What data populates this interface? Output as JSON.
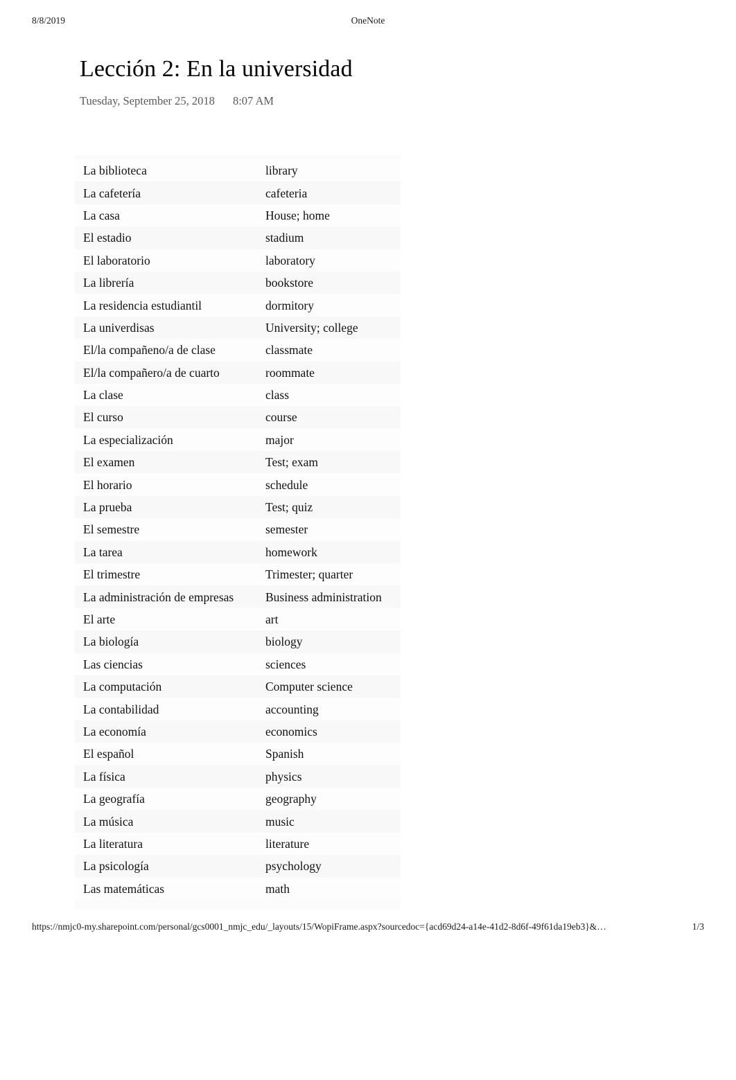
{
  "print_header": {
    "date": "8/8/2019",
    "app_name": "OneNote"
  },
  "note": {
    "title": "Lección 2: En la universidad",
    "date": "Tuesday, September 25, 2018",
    "time": "8:07 AM"
  },
  "vocab_table": {
    "rows": [
      {
        "spanish": "La biblioteca",
        "english": "library"
      },
      {
        "spanish": "La cafetería",
        "english": "cafeteria"
      },
      {
        "spanish": "La casa",
        "english": "House; home"
      },
      {
        "spanish": "El estadio",
        "english": "stadium"
      },
      {
        "spanish": "El laboratorio",
        "english": "laboratory"
      },
      {
        "spanish": "La librería",
        "english": "bookstore"
      },
      {
        "spanish": "La residencia estudiantil",
        "english": "dormitory"
      },
      {
        "spanish": "La univerdisas",
        "english": "University; college"
      },
      {
        "spanish": "El/la compañeno/a de clase",
        "english": "classmate"
      },
      {
        "spanish": "El/la compañero/a de cuarto",
        "english": "roommate"
      },
      {
        "spanish": "La clase",
        "english": "class"
      },
      {
        "spanish": "El curso",
        "english": "course"
      },
      {
        "spanish": "La especialización",
        "english": "major"
      },
      {
        "spanish": "El examen",
        "english": "Test; exam"
      },
      {
        "spanish": "El horario",
        "english": "schedule"
      },
      {
        "spanish": "La prueba",
        "english": "Test; quiz"
      },
      {
        "spanish": "El semestre",
        "english": "semester"
      },
      {
        "spanish": "La tarea",
        "english": "homework"
      },
      {
        "spanish": "El trimestre",
        "english": "Trimester; quarter"
      },
      {
        "spanish": "La administración de empresas",
        "english": "Business administration"
      },
      {
        "spanish": "El arte",
        "english": "art"
      },
      {
        "spanish": "La biología",
        "english": "biology"
      },
      {
        "spanish": "Las ciencias",
        "english": "sciences"
      },
      {
        "spanish": "La computación",
        "english": "Computer science"
      },
      {
        "spanish": "La contabilidad",
        "english": "accounting"
      },
      {
        "spanish": "La economía",
        "english": "economics"
      },
      {
        "spanish": "El español",
        "english": "Spanish"
      },
      {
        "spanish": "La física",
        "english": "physics"
      },
      {
        "spanish": "La geografía",
        "english": "geography"
      },
      {
        "spanish": "La música",
        "english": "music"
      },
      {
        "spanish": "La literatura",
        "english": "literature"
      },
      {
        "spanish": "La psicología",
        "english": "psychology"
      },
      {
        "spanish": "Las matemáticas",
        "english": "math"
      }
    ]
  },
  "print_footer": {
    "url": "https://nmjc0-my.sharepoint.com/personal/gcs0001_nmjc_edu/_layouts/15/WopiFrame.aspx?sourcedoc={acd69d24-a14e-41d2-8d6f-49f61da19eb3}&…",
    "page_indicator": "1/3"
  }
}
